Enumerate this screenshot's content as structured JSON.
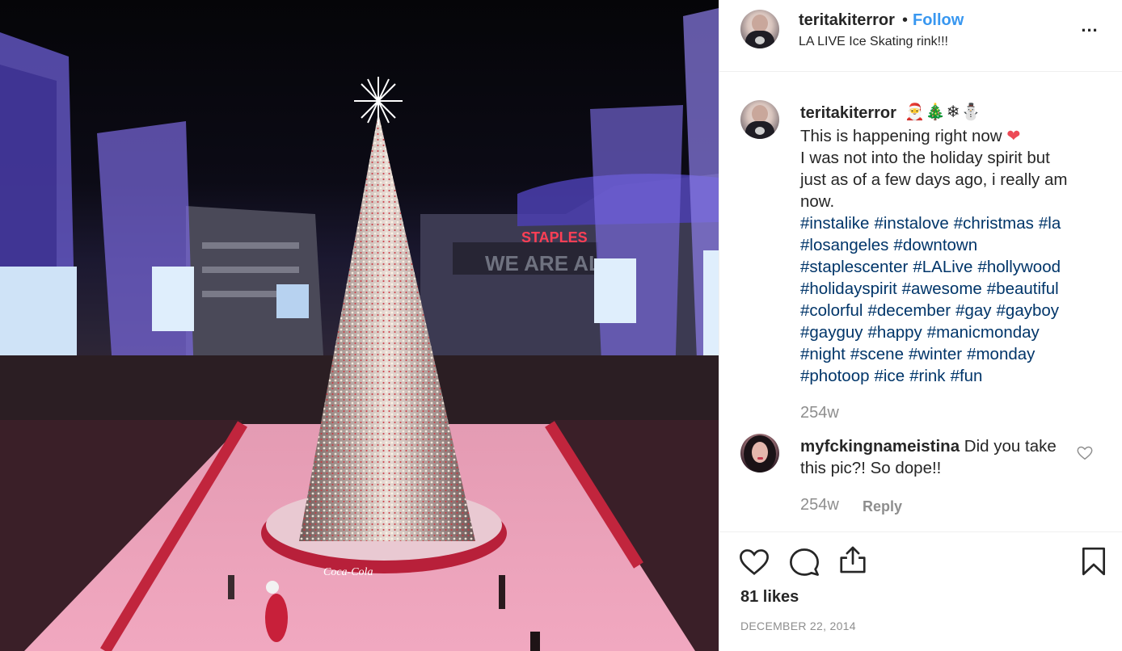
{
  "post": {
    "image_alt": "LA LIVE Ice Skating rink",
    "photo_signs": {
      "staples": "STAPLES",
      "we_are": "WE ARE AL",
      "coca_cola": "Coca-Cola"
    }
  },
  "header": {
    "username": "teritakiterror",
    "separator": "•",
    "follow_label": "Follow",
    "location": "LA LIVE Ice Skating rink!!!",
    "more_label": "..."
  },
  "caption": {
    "username": "teritakiterror",
    "emojis": "🎅🎄❄⛄",
    "lines": [
      "This is happening right now",
      "I was not into the holiday spirit but",
      "just as of a few days ago, i really am",
      "now."
    ],
    "heart": "❤",
    "hashtag_lines": [
      [
        "#instalike",
        "#instalove",
        "#christmas",
        "#la"
      ],
      [
        "#losangeles",
        "#downtown"
      ],
      [
        "#staplescenter",
        "#LALive",
        "#hollywood"
      ],
      [
        "#holidayspirit",
        "#awesome",
        "#beautiful"
      ],
      [
        "#colorful",
        "#december",
        "#gay",
        "#gayboy"
      ],
      [
        "#gayguy",
        "#happy",
        "#manicmonday"
      ],
      [
        "#night",
        "#scene",
        "#winter",
        "#monday"
      ],
      [
        "#photoop",
        "#ice",
        "#rink",
        "#fun"
      ]
    ],
    "time": "254w"
  },
  "comments": [
    {
      "username": "myfckingnameistina",
      "text": "Did you take this pic?! So dope!!",
      "time": "254w",
      "reply_label": "Reply"
    }
  ],
  "stats": {
    "likes": "81 likes",
    "date": "DECEMBER 22, 2014"
  },
  "icons": {
    "like": "heart-outline-icon",
    "comment": "speech-bubble-icon",
    "share": "share-icon",
    "save": "bookmark-icon",
    "more": "more-dots-icon"
  },
  "colors": {
    "link_blue": "#3897f0",
    "hashtag": "#003569",
    "muted": "#8e8e8e",
    "heart_red": "#ed4956",
    "text": "#262626"
  }
}
